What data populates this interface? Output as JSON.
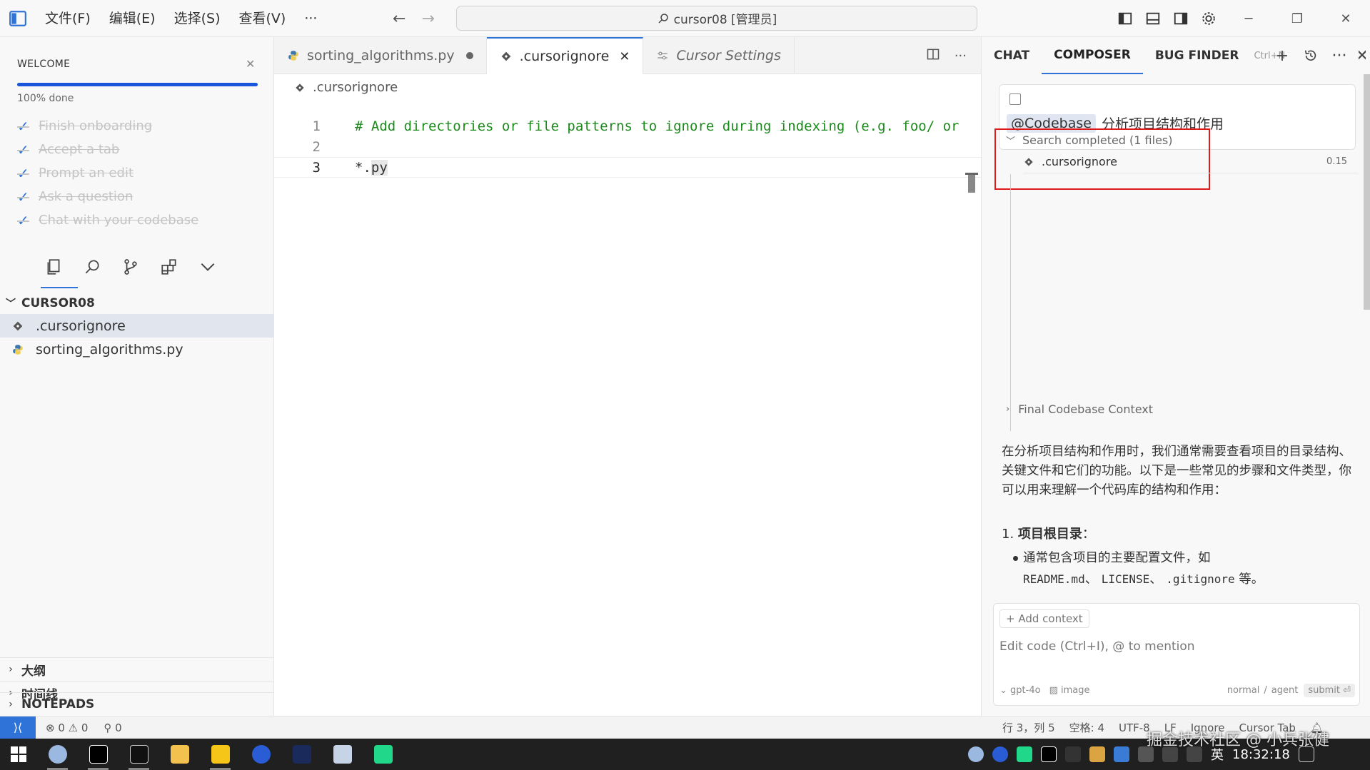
{
  "titlebar": {
    "menu": [
      "文件(F)",
      "编辑(E)",
      "选择(S)",
      "查看(V)",
      "···"
    ],
    "command_center": "cursor08 [管理员]"
  },
  "welcome": {
    "title": "WELCOME",
    "progress_text": "100% done",
    "progress": 1.0,
    "steps": [
      "Finish onboarding",
      "Accept a tab",
      "Prompt an edit",
      "Ask a question",
      "Chat with your codebase"
    ]
  },
  "explorer": {
    "folder": "CURSOR08",
    "files": [
      ".cursorignore",
      "sorting_algorithms.py"
    ],
    "sections": [
      "大纲",
      "时间线",
      "NOTEPADS"
    ]
  },
  "editor": {
    "tabs": [
      {
        "label": "sorting_algorithms.py",
        "state": "modified"
      },
      {
        "label": ".cursorignore",
        "state": "active"
      },
      {
        "label": "Cursor Settings",
        "state": "preview"
      }
    ],
    "breadcrumb": ".cursorignore",
    "lines": [
      {
        "n": "1",
        "text": "# Add directories or file patterns to ignore during indexing (e.g. foo/ or"
      },
      {
        "n": "2",
        "text": ""
      },
      {
        "n": "3",
        "text_a": "*.",
        "text_b": "py"
      }
    ]
  },
  "panel": {
    "tabs": [
      "CHAT",
      "COMPOSER",
      "BUG FINDER"
    ],
    "shortcut": "Ctrl+N",
    "query_tag": "@Codebase",
    "query_text": "分析项目结构和作用",
    "search_head": "Search completed (1 files)",
    "search_file": ".cursorignore",
    "search_score": "0.15",
    "final_ctx": "Final Codebase Context",
    "answer": "在分析项目结构和作用时，我们通常需要查看项目的目录结构、关键文件和它们的功能。以下是一些常见的步骤和文件类型，你可以用来理解一个代码库的结构和作用：",
    "answer_heading_num": "1. ",
    "answer_heading": "项目根目录",
    "answer_heading_tail": "：",
    "bullet_text": "通常包含项目的主要配置文件，如",
    "bullet_code_1": "README.md",
    "bullet_sep_1": "、",
    "bullet_code_2": "LICENSE",
    "bullet_sep_2": "、",
    "bullet_code_3": ".gitignore",
    "bullet_tail": " 等。",
    "add_context": "+ Add context",
    "compose_placeholder": "Edit code (Ctrl+I), @ to mention",
    "model": "gpt-4o",
    "image": "image",
    "mode": "normal",
    "mode_sep": "/",
    "agent": "agent",
    "submit": "submit ⏎"
  },
  "statusbar": {
    "errors": "⊗ 0 ⚠ 0",
    "ports": "⚲ 0",
    "position": "行 3，列 5",
    "spaces": "空格: 4",
    "encoding": "UTF-8",
    "eol": "LF",
    "language": "Ignore",
    "cursor_tab": "Cursor Tab"
  },
  "taskbar": {
    "ime": "英",
    "time": "18:32:18"
  },
  "watermark": "掘金技术社区 @ 小兵张健"
}
